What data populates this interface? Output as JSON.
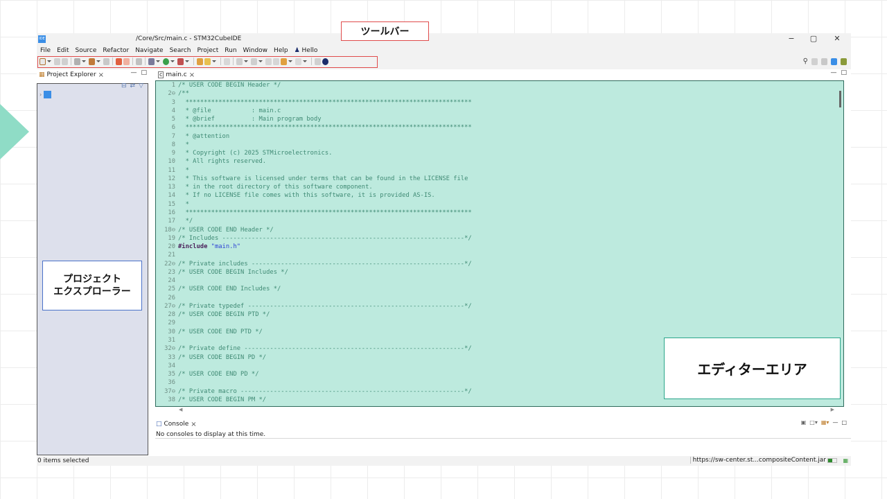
{
  "window": {
    "title": "/Core/Src/main.c - STM32CubeIDE",
    "app_icon_text": "IDE",
    "minimize_glyph": "−",
    "restore_glyph": "▢",
    "close_glyph": "✕"
  },
  "menu": {
    "items": [
      "File",
      "Edit",
      "Source",
      "Refactor",
      "Navigate",
      "Search",
      "Project",
      "Run",
      "Window",
      "Help"
    ],
    "user_label": "Hello"
  },
  "callouts": {
    "toolbar": "ツールバー",
    "explorer_line1": "プロジェクト",
    "explorer_line2": "エクスプローラー",
    "editor": "エディターエリア"
  },
  "colors": {
    "highlight_red": "#e04b4b",
    "editor_bg": "#bdeade",
    "explorer_bg": "#dde0ec",
    "accent": "#2aa58a"
  },
  "project_explorer": {
    "tab_label": "Project Explorer"
  },
  "editor": {
    "tab_label": "main.c",
    "lines": [
      {
        "n": "1",
        "text": "/* USER CODE BEGIN Header */"
      },
      {
        "n": "2⊖",
        "text": "/**"
      },
      {
        "n": "3",
        "text": "  ******************************************************************************"
      },
      {
        "n": "4",
        "text": "  * @file           : main.c"
      },
      {
        "n": "5",
        "text": "  * @brief          : Main program body"
      },
      {
        "n": "6",
        "text": "  ******************************************************************************"
      },
      {
        "n": "7",
        "text": "  * @attention"
      },
      {
        "n": "8",
        "text": "  *"
      },
      {
        "n": "9",
        "text": "  * Copyright (c) 2025 STMicroelectronics."
      },
      {
        "n": "10",
        "text": "  * All rights reserved."
      },
      {
        "n": "11",
        "text": "  *"
      },
      {
        "n": "12",
        "text": "  * This software is licensed under terms that can be found in the LICENSE file"
      },
      {
        "n": "13",
        "text": "  * in the root directory of this software component."
      },
      {
        "n": "14",
        "text": "  * If no LICENSE file comes with this software, it is provided AS-IS."
      },
      {
        "n": "15",
        "text": "  *"
      },
      {
        "n": "16",
        "text": "  ******************************************************************************"
      },
      {
        "n": "17",
        "text": "  */"
      },
      {
        "n": "18⊖",
        "text": "/* USER CODE END Header */"
      },
      {
        "n": "19",
        "text": "/* Includes ------------------------------------------------------------------*/"
      },
      {
        "n": "20",
        "kw": "#include ",
        "str": "\"main.h\""
      },
      {
        "n": "21",
        "text": ""
      },
      {
        "n": "22⊖",
        "text": "/* Private includes ----------------------------------------------------------*/"
      },
      {
        "n": "23",
        "text": "/* USER CODE BEGIN Includes */"
      },
      {
        "n": "24",
        "text": ""
      },
      {
        "n": "25",
        "text": "/* USER CODE END Includes */"
      },
      {
        "n": "26",
        "text": ""
      },
      {
        "n": "27⊖",
        "text": "/* Private typedef -----------------------------------------------------------*/"
      },
      {
        "n": "28",
        "text": "/* USER CODE BEGIN PTD */"
      },
      {
        "n": "29",
        "text": ""
      },
      {
        "n": "30",
        "text": "/* USER CODE END PTD */"
      },
      {
        "n": "31",
        "text": ""
      },
      {
        "n": "32⊖",
        "text": "/* Private define ------------------------------------------------------------*/"
      },
      {
        "n": "33",
        "text": "/* USER CODE BEGIN PD */"
      },
      {
        "n": "34",
        "text": ""
      },
      {
        "n": "35",
        "text": "/* USER CODE END PD */"
      },
      {
        "n": "36",
        "text": ""
      },
      {
        "n": "37⊖",
        "text": "/* Private macro -------------------------------------------------------------*/"
      },
      {
        "n": "38",
        "text": "/* USER CODE BEGIN PM */"
      }
    ]
  },
  "console": {
    "tab_label": "Console",
    "message": "No consoles to display at this time."
  },
  "status": {
    "selection": "0 items selected",
    "url": "https://sw-center.st...compositeContent.jar",
    "progress": 0.5
  }
}
